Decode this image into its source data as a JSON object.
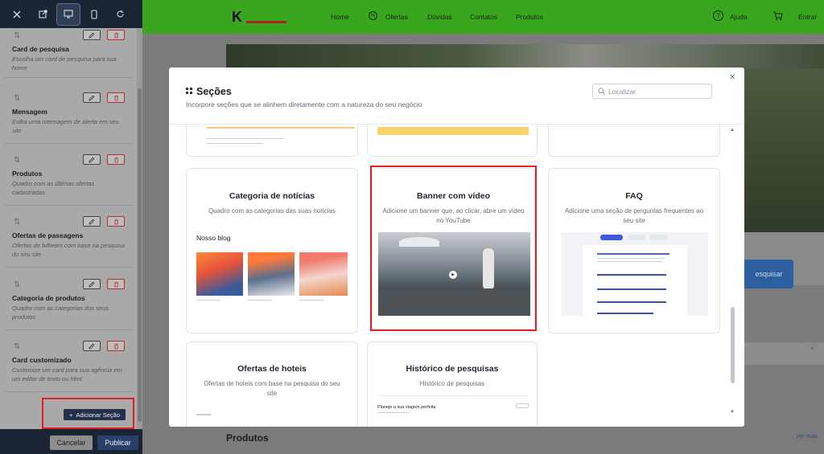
{
  "colors": {
    "sidebar_dark": "#1b2433",
    "nav_green": "#3aa51e",
    "highlight_red": "#e02020",
    "accent_blue": "#2b3f6b"
  },
  "sidebar": {
    "toolbar_icons": [
      "close-icon",
      "external-link-icon",
      "desktop-icon",
      "mobile-icon",
      "refresh-icon"
    ],
    "items": [
      {
        "name": "Card de pesquisa",
        "description": "Escolha um card de pesquisa para sua home"
      },
      {
        "name": "Mensagem",
        "description": "Exiba uma mensagem de alerta em seu site"
      },
      {
        "name": "Produtos",
        "description": "Quadro com as últimas ofertas cadastradas"
      },
      {
        "name": "Ofertas de passagens",
        "description": "Ofertas de bilhetes com base na pesquisa do seu site"
      },
      {
        "name": "Categoria de produtos",
        "description": "Quadro com as categorias dos seus produtos"
      },
      {
        "name": "Card customizado",
        "description": "Customize um card para sua agência em um editor de texto ou html"
      }
    ],
    "add_section_label": "Adicionar Seção",
    "cancel_label": "Cancelar",
    "publish_label": "Publicar"
  },
  "site": {
    "logo_text": "K",
    "nav_links": [
      "Home",
      "Ofertas",
      "Dúvidas",
      "Contatos",
      "Produtos"
    ],
    "help_label": "Ajuda",
    "login_label": "Entrar",
    "search_button_partial": "esquisar",
    "products_heading": "Produtos",
    "see_more": "Ver mais"
  },
  "modal": {
    "title": "Seções",
    "subtitle": "Incorpore seções que se alinhem diretamente com a natureza do seu negócio",
    "search_placeholder": "Localizar",
    "cards": [
      {
        "title": "Categoria de notícias",
        "description": "Quadro com as categorias das suas notícias",
        "preview_heading": "Nosso blog"
      },
      {
        "title": "Banner com vídeo",
        "description": "Adicione um banner que, ao clicar, abre um vídeo no YouTube"
      },
      {
        "title": "FAQ",
        "description": "Adicione uma seção de perguntas frequentes ao seu site"
      },
      {
        "title": "Ofertas de hoteis",
        "description": "Ofertas de hoteis com base na pesquisa do seu site"
      },
      {
        "title": "Histórico de pesquisas",
        "description": "Histórico de pesquisas",
        "preview_heading": "Planeje a sua viagem perfeita"
      }
    ]
  }
}
